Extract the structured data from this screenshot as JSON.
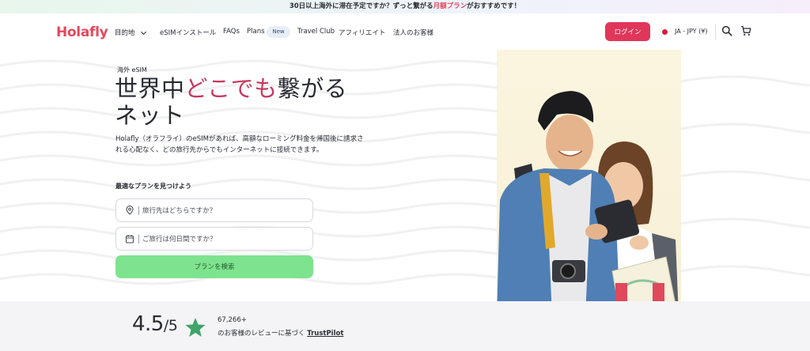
{
  "banner": {
    "text_before": "30日以上海外に滞在予定ですか？ずっと繋がる",
    "highlight": "月額プラン",
    "text_after": "がおすすめです！"
  },
  "nav": {
    "logo": "Holafly",
    "destination": "目的地",
    "install": "eSIMインストール",
    "faqs": "FAQs",
    "plans": "Plans",
    "plans_badge": "New",
    "travel_club": "Travel Club",
    "affiliate": "アフィリエイト",
    "corporate": "法人のお客様",
    "login": "ログイン",
    "currency": "JA - JPY (¥)"
  },
  "hero": {
    "eyebrow": "海外 eSIM",
    "headline_before": "世界中",
    "headline_highlight": "どこでも",
    "headline_after": "繋がる",
    "headline_line2": "ネット",
    "lead": "Holafly（オラフライ）のeSIMがあれば、高額なローミング料金を帰国後に請求される心配なく、どの旅行先からでもインターネットに接続できます。",
    "find_label": "最適なプランを見つけよう",
    "destination_placeholder": "旅行先はどちらですか？",
    "duration_placeholder": "ご旅行は何日間ですか？",
    "search_button": "プランを検索"
  },
  "rating": {
    "score": "4.5",
    "out_of": "/5",
    "count": "67,266+",
    "review_text": "のお客様のレビューに基づく",
    "trustpilot": "TrustPilot"
  },
  "colors": {
    "brand": "#e6485c",
    "login": "#e0365a",
    "search_button": "#7ee38e",
    "star": "#3fa56a"
  }
}
